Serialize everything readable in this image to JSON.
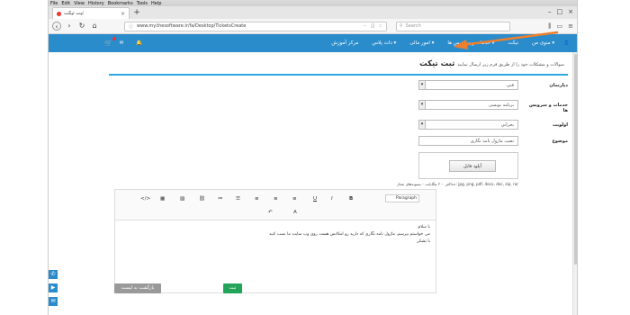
{
  "menubar": [
    "File",
    "Edit",
    "View",
    "History",
    "Bookmarks",
    "Tools",
    "Help"
  ],
  "tab": {
    "title": "ثبت تیکت",
    "close": "×",
    "new": "+"
  },
  "window_controls": [
    "–",
    "□",
    "×"
  ],
  "url": "www.my.thesoftware.ir/fa/Desktop/TicketsCreate",
  "search_placeholder": "Search",
  "header": {
    "nav": [
      "مرکز آموزش",
      "دات پلاس ▾",
      "امور مالی ▾",
      "خدمات و سرویس ها ▾",
      "تیکت",
      "منوی من ▾"
    ],
    "user_icon": "user-icon",
    "cart_icon": "cart-icon",
    "mail_icon": "mail-icon",
    "bell_icon": "bell-icon"
  },
  "page": {
    "title": "ثبت تیکت",
    "subtitle": "سوالات و مشکلات خود را از طریق فرم زیر ارسال نمایید"
  },
  "form": {
    "department_label": "دپارتمان",
    "department_value": "فنی",
    "services_label": "خدمات و سرویس ها",
    "services_value": "برنامه نویسی",
    "priority_label": "اولویت",
    "priority_value": "بحرانی",
    "subject_label": "موضوع",
    "subject_value": "نصب ماژول نامه نگاری",
    "upload_button": "آپلود فایل",
    "upload_hint": "حداکثر ۲۰۰ مگابایت - پسوندهای مجاز: jpg, png, pdf, docx, doc, zip, rar",
    "paragraph_select": "Paragraph",
    "message_lines": [
      "با سلام",
      "می خواستم بپرسم، ماژول نامه نگاری که دارید رو امکانش هست روی وب سایت ما نصب کنید",
      "با تشکر"
    ],
    "submit": "ثبت",
    "back": "بازگشت به لیست"
  },
  "toolbar_icons": [
    "code",
    "table",
    "image",
    "link",
    "ol",
    "ul",
    "align-right",
    "align-center",
    "align-left",
    "underline",
    "italic",
    "bold",
    "undo",
    "font-color"
  ],
  "colors": {
    "header": "#2b8ccc",
    "accent_line": "#2ba8de",
    "submit": "#22a45a",
    "back": "#999999",
    "arrow": "#ef7f2c"
  }
}
